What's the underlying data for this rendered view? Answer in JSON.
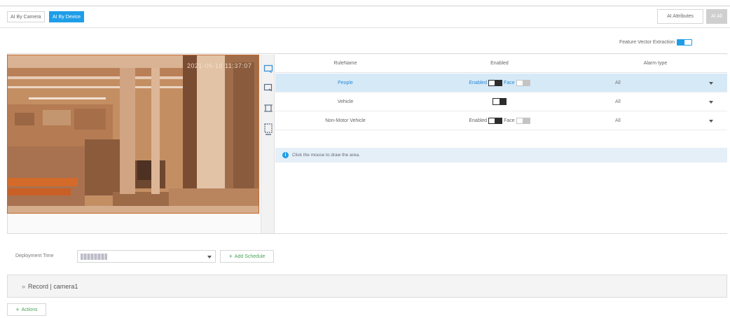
{
  "tabs": [
    {
      "label": "AI By Camera",
      "active": false
    },
    {
      "label": "AI By Device",
      "active": true
    }
  ],
  "toolbar": {
    "all_attributes_label": "AI Attributes",
    "all_label": "AI All"
  },
  "feature_vector": {
    "label": "Feature Vector Extraction",
    "enabled": true
  },
  "preview": {
    "timestamp": "2021-06-18 11:37:07"
  },
  "tools": [
    {
      "icon": "draw-area-icon"
    },
    {
      "icon": "clear-area-icon"
    },
    {
      "icon": "min-size-icon"
    },
    {
      "icon": "max-size-icon"
    }
  ],
  "rules_table": {
    "headers": [
      "RuleName",
      "Enabled",
      "Alarm type"
    ],
    "rows": [
      {
        "name": "People",
        "enabled_label": "Enabled",
        "face_label": "Face",
        "alarm_type": "All",
        "selected": true
      },
      {
        "name": "Vehicle",
        "alarm_type": "All",
        "selected": false
      },
      {
        "name": "Non-Motor Vehicle",
        "enabled_label": "Enabled",
        "face_label": "Face",
        "alarm_type": "All",
        "selected": false
      }
    ]
  },
  "hint": {
    "text": "Click the mouse to draw the area."
  },
  "deployment": {
    "label": "Deployment Time",
    "add_schedule_label": "Add Schedule"
  },
  "record": {
    "text": "Record | camera1"
  },
  "actions": {
    "label": "Actions"
  },
  "colors": {
    "accent": "#1e9ee8",
    "preview_tint": "#c56b2f",
    "selected_row": "#d6e9f7",
    "add_green": "#4aa35a"
  }
}
